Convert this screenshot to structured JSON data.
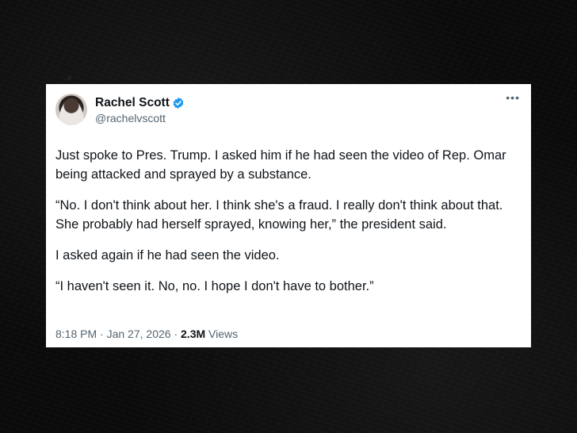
{
  "tweet": {
    "author": {
      "display_name": "Rachel Scott",
      "handle": "@rachelvscott",
      "verified": true
    },
    "more_icon": "more-horizontal-icon",
    "paragraphs": [
      "Just spoke to Pres. Trump. I asked him if he had seen the video of Rep. Omar being attacked and sprayed by a substance.",
      "“No. I don't think about her. I think she's a fraud. I really don't think about that. She probably had herself sprayed, knowing her,” the president said.",
      "I asked again if he had seen the video.",
      "“I haven't seen it. No, no. I hope I don't have to bother.”"
    ],
    "time": "8:18 PM",
    "date": "Jan 27, 2026",
    "separator": "·",
    "views_count": "2.3M",
    "views_label": "Views"
  },
  "colors": {
    "verified_blue": "#1d9bf0",
    "secondary_text": "#536471",
    "primary_text": "#0f1419",
    "background": "#0b0b0b"
  }
}
